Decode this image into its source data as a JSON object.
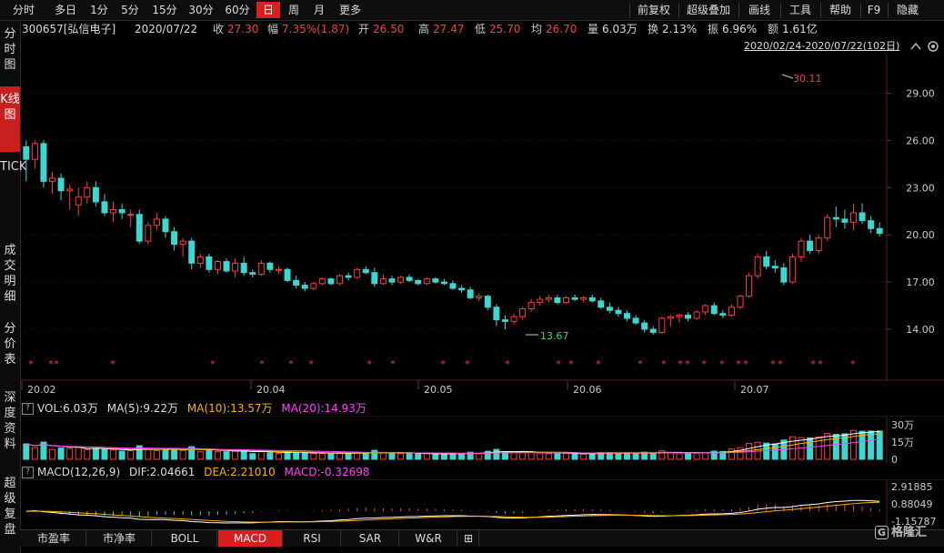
{
  "toolbar": {
    "left": [
      "分时",
      "多日",
      "1分",
      "5分",
      "15分",
      "30分",
      "60分",
      "日",
      "周",
      "月",
      "更多"
    ],
    "active": "日",
    "right": [
      "前复权",
      "超级叠加",
      "画线",
      "工具",
      "帮助",
      "F9",
      "隐藏"
    ]
  },
  "stock_info": {
    "code_name": "300657[弘信电子]",
    "date": "2020/07/22",
    "close_label": "收",
    "close": "27.30",
    "change_label": "幅",
    "change": "7.35%(1.87)",
    "open_label": "开",
    "open": "26.50",
    "high_label": "高",
    "high": "27.47",
    "low_label": "低",
    "low": "25.70",
    "avg_label": "均",
    "avg": "26.70",
    "volume_label": "量",
    "volume": "6.03万",
    "turnover_label": "换",
    "turnover": "2.13%",
    "amplitude_label": "振",
    "amplitude": "6.96%",
    "amount_label": "额",
    "amount": "1.61亿"
  },
  "date_range": "2020/02/24-2020/07/22(102日)",
  "sidebar": {
    "timeshare": "分时图",
    "kline": "K线图",
    "tick": "TICK",
    "deals": "成交明细",
    "price_table": "分价表",
    "depth": "深度资料",
    "super_review": "超级复盘"
  },
  "price_axis": [
    "29.00",
    "26.00",
    "23.00",
    "20.00",
    "17.00",
    "14.00"
  ],
  "date_axis": [
    "20.02",
    "20.04",
    "20.05",
    "20.06",
    "20.07"
  ],
  "annotations": {
    "high": "30.11",
    "low": "13.67"
  },
  "volume_panel": {
    "title": "VOL:6.03万",
    "ma5": "MA(5):9.22万",
    "ma10": "MA(10):13.57万",
    "ma20": "MA(20):14.93万",
    "axis": [
      "30万",
      "15万",
      "0"
    ]
  },
  "macd_panel": {
    "title": "MACD(12,26,9)",
    "dif": "DIF:2.04661",
    "dea": "DEA:2.21010",
    "macd": "MACD:-0.32698",
    "axis": [
      "2.91885",
      "0.88049",
      "-1.15787"
    ]
  },
  "bottom_tabs": [
    "市盈率",
    "市净率",
    "BOLL",
    "MACD",
    "RSI",
    "SAR",
    "W&R",
    "⊞"
  ],
  "bottom_active": "MACD",
  "logo": "格隆汇",
  "colors": {
    "up": "#ff3b3b",
    "down": "#3dd6d0",
    "ma5": "#ffffff",
    "ma10": "#ffb000",
    "ma20": "#ff40ff",
    "active": "#d81e1e"
  },
  "chart_data": {
    "type": "candlestick",
    "ohlc": [
      [
        25.6,
        26.0,
        23.4,
        24.8
      ],
      [
        24.8,
        26.0,
        24.2,
        25.8
      ],
      [
        25.8,
        26.0,
        23.0,
        23.4
      ],
      [
        23.4,
        24.0,
        22.6,
        23.6
      ],
      [
        23.6,
        23.9,
        22.2,
        22.8
      ],
      [
        22.8,
        23.2,
        21.6,
        22.9
      ],
      [
        21.9,
        23.0,
        21.2,
        22.4
      ],
      [
        22.4,
        23.4,
        22.0,
        23.0
      ],
      [
        23.0,
        23.4,
        21.8,
        22.1
      ],
      [
        22.1,
        22.6,
        21.2,
        21.4
      ],
      [
        21.4,
        22.1,
        20.8,
        21.6
      ],
      [
        21.6,
        22.0,
        21.0,
        21.4
      ],
      [
        21.3,
        21.6,
        20.5,
        21.3
      ],
      [
        21.3,
        21.6,
        19.4,
        19.6
      ],
      [
        19.6,
        20.8,
        19.4,
        20.6
      ],
      [
        20.6,
        21.4,
        20.3,
        21.0
      ],
      [
        21.0,
        21.2,
        19.8,
        20.2
      ],
      [
        20.2,
        20.5,
        19.0,
        19.4
      ],
      [
        19.4,
        19.8,
        18.6,
        19.6
      ],
      [
        19.6,
        19.8,
        17.8,
        18.2
      ],
      [
        18.2,
        18.8,
        17.9,
        18.6
      ],
      [
        18.6,
        18.8,
        17.6,
        17.8
      ],
      [
        17.8,
        18.4,
        17.5,
        18.3
      ],
      [
        18.3,
        18.5,
        17.6,
        17.7
      ],
      [
        17.7,
        18.5,
        17.3,
        18.2
      ],
      [
        18.2,
        18.6,
        17.4,
        17.6
      ],
      [
        17.6,
        17.8,
        17.3,
        17.5
      ],
      [
        17.5,
        18.4,
        17.4,
        18.2
      ],
      [
        18.2,
        18.3,
        17.6,
        17.8
      ],
      [
        17.8,
        18.0,
        17.5,
        17.8
      ],
      [
        17.8,
        17.9,
        17.0,
        17.1
      ],
      [
        17.1,
        17.4,
        16.6,
        16.8
      ],
      [
        16.8,
        17.0,
        16.4,
        16.6
      ],
      [
        16.6,
        17.0,
        16.5,
        16.9
      ],
      [
        16.9,
        17.3,
        16.8,
        17.2
      ],
      [
        17.2,
        17.3,
        16.8,
        16.9
      ],
      [
        16.9,
        17.5,
        16.8,
        17.4
      ],
      [
        17.4,
        17.6,
        17.1,
        17.3
      ],
      [
        17.3,
        17.9,
        17.2,
        17.8
      ],
      [
        17.8,
        18.0,
        17.5,
        17.6
      ],
      [
        17.6,
        17.9,
        16.7,
        16.9
      ],
      [
        16.9,
        17.5,
        16.8,
        17.2
      ],
      [
        17.2,
        17.4,
        16.8,
        17.0
      ],
      [
        17.0,
        17.4,
        16.9,
        17.3
      ],
      [
        17.3,
        17.5,
        17.0,
        17.1
      ],
      [
        17.1,
        17.2,
        16.8,
        16.9
      ],
      [
        16.9,
        17.3,
        16.8,
        17.2
      ],
      [
        17.2,
        17.3,
        16.9,
        17.0
      ],
      [
        17.0,
        17.2,
        16.8,
        16.9
      ],
      [
        16.9,
        17.1,
        16.5,
        16.6
      ],
      [
        16.6,
        16.8,
        16.3,
        16.5
      ],
      [
        16.5,
        16.7,
        15.9,
        16.0
      ],
      [
        16.0,
        16.3,
        15.8,
        16.1
      ],
      [
        16.1,
        16.2,
        15.2,
        15.4
      ],
      [
        15.4,
        15.6,
        14.2,
        14.6
      ],
      [
        14.6,
        14.9,
        14.0,
        14.5
      ],
      [
        14.5,
        15.0,
        14.3,
        14.8
      ],
      [
        14.8,
        15.4,
        14.6,
        15.3
      ],
      [
        15.3,
        15.9,
        15.1,
        15.7
      ],
      [
        15.7,
        16.1,
        15.5,
        15.9
      ],
      [
        15.9,
        16.2,
        15.7,
        16.0
      ],
      [
        16.0,
        16.2,
        15.6,
        15.7
      ],
      [
        15.7,
        16.1,
        15.6,
        16.0
      ],
      [
        16.0,
        16.2,
        15.8,
        15.9
      ],
      [
        15.9,
        16.1,
        15.7,
        16.0
      ],
      [
        16.0,
        16.2,
        15.7,
        15.8
      ],
      [
        15.8,
        16.0,
        15.3,
        15.4
      ],
      [
        15.4,
        15.7,
        15.0,
        15.2
      ],
      [
        15.2,
        15.4,
        14.8,
        15.0
      ],
      [
        15.0,
        15.2,
        14.5,
        14.7
      ],
      [
        14.7,
        14.9,
        14.3,
        14.4
      ],
      [
        14.4,
        14.6,
        13.8,
        14.0
      ],
      [
        14.0,
        14.2,
        13.67,
        13.8
      ],
      [
        13.8,
        14.8,
        13.7,
        14.7
      ],
      [
        14.7,
        14.9,
        14.2,
        14.8
      ],
      [
        14.8,
        15.0,
        14.4,
        14.9
      ],
      [
        14.9,
        15.1,
        14.5,
        14.7
      ],
      [
        14.7,
        15.2,
        14.6,
        15.1
      ],
      [
        15.1,
        15.6,
        14.9,
        15.5
      ],
      [
        15.5,
        15.7,
        14.9,
        15.0
      ],
      [
        15.0,
        15.2,
        14.7,
        14.9
      ],
      [
        14.9,
        15.6,
        14.8,
        15.4
      ],
      [
        15.4,
        16.2,
        15.3,
        16.1
      ],
      [
        16.1,
        17.6,
        16.0,
        17.4
      ],
      [
        17.4,
        18.8,
        17.2,
        18.6
      ],
      [
        18.6,
        19.0,
        17.8,
        18.0
      ],
      [
        18.0,
        18.4,
        17.6,
        17.9
      ],
      [
        17.9,
        18.2,
        16.8,
        17.0
      ],
      [
        17.0,
        18.8,
        16.9,
        18.6
      ],
      [
        18.6,
        19.8,
        18.3,
        19.6
      ],
      [
        19.6,
        20.0,
        18.8,
        19.0
      ],
      [
        19.0,
        20.0,
        18.8,
        19.8
      ],
      [
        19.8,
        21.3,
        19.6,
        21.1
      ],
      [
        21.1,
        21.8,
        20.5,
        21.0
      ],
      [
        21.0,
        21.6,
        20.4,
        20.8
      ],
      [
        20.8,
        22.0,
        20.3,
        21.4
      ],
      [
        21.4,
        22.0,
        20.7,
        20.9
      ],
      [
        20.9,
        21.2,
        20.1,
        20.4
      ],
      [
        20.4,
        20.8,
        19.9,
        20.1
      ]
    ],
    "volume_axis": [
      0,
      30
    ],
    "macd_axis": [
      -1.15787,
      2.91885
    ]
  }
}
